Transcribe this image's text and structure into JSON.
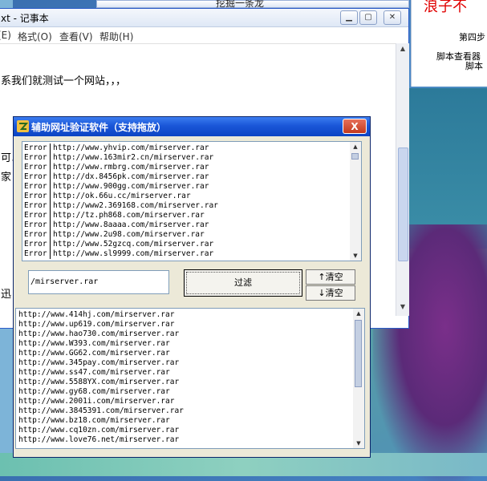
{
  "top_window": {
    "title": "挖掘一条龙"
  },
  "right_window": {
    "red_text": "浪子不",
    "lines": [
      "第四步",
      "脚本查看器",
      "脚本"
    ]
  },
  "notepad": {
    "title": "xt - 记事本",
    "menu": [
      "(E)",
      "格式(O)",
      "查看(V)",
      "帮助(H)"
    ],
    "lines": [
      "系我们就测试一个网站，，，",
      "可以",
      "家",
      "迅"
    ]
  },
  "dialog": {
    "title": "辅助网址验证软件（支持拖放）",
    "close_label": "X",
    "status_rows": [
      {
        "status": "Error",
        "url": "http://www.yhvip.com/mirserver.rar"
      },
      {
        "status": "Error",
        "url": "http://www.163mir2.cn/mirserver.rar"
      },
      {
        "status": "Error",
        "url": "http://www.rmbrg.com/mirserver.rar"
      },
      {
        "status": "Error",
        "url": "http://dx.8456pk.com/mirserver.rar"
      },
      {
        "status": "Error",
        "url": "http://www.900gg.com/mirserver.rar"
      },
      {
        "status": "Error",
        "url": "http://ok.66u.cc/mirserver.rar"
      },
      {
        "status": "Error",
        "url": "http://www2.369168.com/mirserver.rar"
      },
      {
        "status": "Error",
        "url": "http://tz.ph868.com/mirserver.rar"
      },
      {
        "status": "Error",
        "url": "http://www.8aaaa.com/mirserver.rar"
      },
      {
        "status": "Error",
        "url": "http://www.2u98.com/mirserver.rar"
      },
      {
        "status": "Error",
        "url": "http://www.52gzcq.com/mirserver.rar"
      },
      {
        "status": "Error",
        "url": "http://www.sl9999.com/mirserver.rar"
      }
    ],
    "filter_value": "/mirserver.rar",
    "filter_button": "过滤",
    "clear_up": "↑清空",
    "clear_down": "↓清空",
    "url_list": [
      "http://www.414hj.com/mirserver.rar",
      "http://www.up619.com/mirserver.rar",
      "http://www.hao730.com/mirserver.rar",
      "http://www.W393.com/mirserver.rar",
      "http://www.GG62.com/mirserver.rar",
      "http://www.345pay.com/mirserver.rar",
      "http://www.ss47.com/mirserver.rar",
      "http://www.5588YX.com/mirserver.rar",
      "http://www.gy68.com/mirserver.rar",
      "http://www.2001i.com/mirserver.rar",
      "http://www.3845391.com/mirserver.rar",
      "http://www.bz18.com/mirserver.rar",
      "http://www.cq10zn.com/mirserver.rar",
      "http://www.love76.net/mirserver.rar"
    ]
  }
}
